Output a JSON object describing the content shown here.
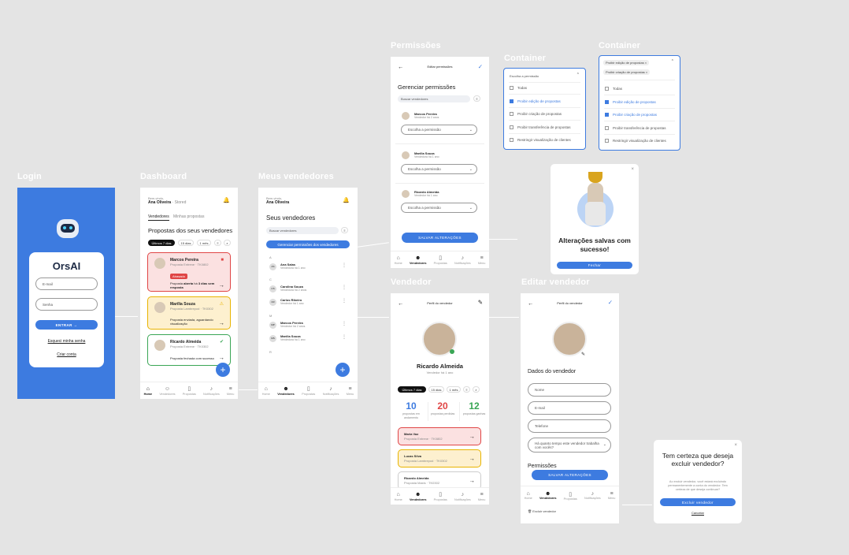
{
  "labels": {
    "login": "Login",
    "dashboard": "Dashboard",
    "meus_vendedores": "Meus vendedores",
    "permissoes": "Permissões",
    "container1": "Container",
    "container2": "Container",
    "vendedor": "Vendedor",
    "editar_vendedor": "Editar vendedor"
  },
  "login": {
    "brand": "OrsAI",
    "email": "E-mail",
    "senha": "Senha",
    "entrar": "ENTRAR →",
    "esqueci": "Esqueci minha senha",
    "criar": "Criar conta"
  },
  "dashboard": {
    "greet": "Bem-vindo,",
    "user": "Ana Oliveira",
    "user_suffix": "· Stored",
    "tab1": "Vendedores",
    "tab2": "Minhas propostas",
    "title": "Propostas dos seus vendedores",
    "filters": [
      "Últimos 7 dias",
      "15 dias",
      "1 mês"
    ],
    "cards": [
      {
        "name": "Marcos Pereira",
        "sub": "Proposta Entrene · TK0802",
        "badge": "Atrasado",
        "msg1": "Proposta ",
        "msg_b": "aberta",
        "msg2": " há ",
        "msg_b2": "3 dias sem resposta"
      },
      {
        "name": "Marília Souza",
        "sub": "Proposta Lambrepod · TK0302",
        "msg": "Proposta enviada, aguardando visualização"
      },
      {
        "name": "Ricardo Almeida",
        "sub": "Proposta Entrene · TK0302",
        "msg": "Proposta fechada com sucesso"
      }
    ]
  },
  "tabs": {
    "home": "Home",
    "vendedores": "Vendedores",
    "propostas": "Propostas",
    "notificacoes": "Notificações",
    "menu": "Menu"
  },
  "meus": {
    "greet": "Bem-vindo,",
    "user": "Ana Oliveira",
    "title": "Seus vendedores",
    "search": "Buscar vendedores",
    "perm_btn": "Gerenciar permissões dos vendedores",
    "groups": [
      {
        "letter": "A",
        "items": [
          {
            "init": "AS",
            "name": "Ana Salas",
            "since": "Vendedora há 1 ano"
          }
        ]
      },
      {
        "letter": "C",
        "items": [
          {
            "init": "CS",
            "name": "Carolina Souza",
            "since": "Vendedora há 2 anos"
          },
          {
            "init": "CR",
            "name": "Carlos Ribeiro",
            "since": "Vendedor há 1 ano"
          }
        ]
      },
      {
        "letter": "M",
        "items": [
          {
            "init": "MP",
            "name": "Marcos Pereira",
            "since": "Vendedor há 2 anos"
          },
          {
            "init": "MS",
            "name": "Marília Souza",
            "since": "Vendedora há 1 ano"
          }
        ]
      },
      {
        "letter": "R",
        "items": []
      }
    ]
  },
  "perm": {
    "header": "Editar permissões",
    "title": "Gerenciar permissões",
    "search": "Buscar vendedores",
    "choose": "Escolha a permissão",
    "save": "SALVAR ALTERAÇÕES",
    "people": [
      {
        "name": "Marcos Pereira",
        "since": "Vendedor há 2 anos"
      },
      {
        "name": "Marília Souza",
        "since": "Vendedora há 1 ano"
      },
      {
        "name": "Ricardo Almeida",
        "since": "Vendedor há 1 ano"
      }
    ]
  },
  "c1": {
    "head": "Escolha a permissão",
    "opts": [
      "Todas",
      "Proibir edição de propostas",
      "Proibir criação de propostas",
      "Proibir transferência de propostas",
      "Restringir visualização de clientes"
    ],
    "checked": [
      false,
      true,
      false,
      false,
      false
    ]
  },
  "c2": {
    "tags": [
      "Proibir edição de propostas ×",
      "Proibir criação de propostas ×"
    ],
    "opts": [
      "Todas",
      "Proibir edição de propostas",
      "Proibir criação de propostas",
      "Proibir transferência de propostas",
      "Restringir visualização de clientes"
    ],
    "checked": [
      false,
      true,
      true,
      false,
      false
    ]
  },
  "success": {
    "msg": "Alterações salvas com sucesso!",
    "btn": "Fechar"
  },
  "vendedor": {
    "header": "Perfil do vendedor",
    "name": "Ricardo Almeida",
    "since": "Vendedor há 1 ano",
    "filters": [
      "Últimos 7 dias",
      "15 dias",
      "1 mês"
    ],
    "stats": [
      {
        "n": "10",
        "l": "propostas em andamento",
        "c": "#3d7be0"
      },
      {
        "n": "20",
        "l": "propostas perdidas",
        "c": "#e04545"
      },
      {
        "n": "12",
        "l": "propostas ganhas",
        "c": "#3aa655"
      }
    ],
    "props": [
      {
        "name": "Maria Vaz",
        "sub": "Proposta Entrene · TK0802"
      },
      {
        "name": "Lucas Silva",
        "sub": "Proposta Lambrepod · TK0302"
      },
      {
        "name": "Ricardo Almeida",
        "sub": "Proposta Maxis · TK0302"
      }
    ]
  },
  "editar": {
    "header": "Perfil do vendedor",
    "section": "Dados do vendedor",
    "nome": "Nome",
    "email": "E-mail",
    "tel": "Telefone",
    "tempo": "Há quanto tempo este vendedor trabalha com vocês?",
    "perm": "Permissões",
    "save": "SALVAR ALTERAÇÕES",
    "excluir": "Excluir vendedor"
  },
  "confirm": {
    "title": "Tem certeza que deseja excluir vendedor?",
    "text": "Ao excluir vendedor, você estará excluindo permanentemente a conta do vendedor. Tem certeza de que deseja continuar?",
    "btn": "Excluir vendedor",
    "cancel": "Cancelar"
  },
  "colors": {
    "accent": "#3d7be0",
    "bg": "#e4e4e4",
    "red": "#e04545",
    "green": "#3aa655",
    "yellow": "#e8b400"
  }
}
